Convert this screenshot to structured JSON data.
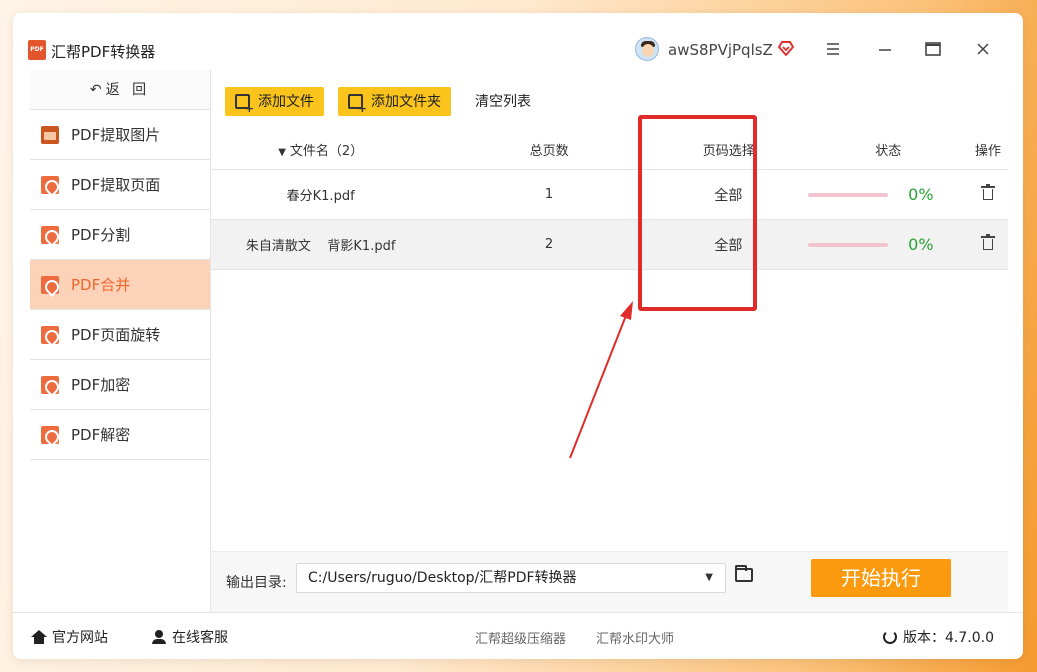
{
  "app": {
    "title": "汇帮PDF转换器",
    "logo_text": "PDF"
  },
  "user": {
    "name": "awS8PVjPqlsZ"
  },
  "sidebar": {
    "back_label": "返 回",
    "items": [
      {
        "label": "PDF提取图片",
        "icon": "image-icon"
      },
      {
        "label": "PDF提取页面",
        "icon": "pdf-icon"
      },
      {
        "label": "PDF分割",
        "icon": "pdf-icon"
      },
      {
        "label": "PDF合并",
        "icon": "pdf-icon",
        "active": true
      },
      {
        "label": "PDF页面旋转",
        "icon": "pdf-icon"
      },
      {
        "label": "PDF加密",
        "icon": "pdf-icon"
      },
      {
        "label": "PDF解密",
        "icon": "pdf-icon"
      }
    ]
  },
  "toolbar": {
    "add_file": "添加文件",
    "add_folder": "添加文件夹",
    "clear_list": "清空列表"
  },
  "table": {
    "headers": {
      "name": "文件名（2）",
      "pages": "总页数",
      "page_select": "页码选择",
      "status": "状态",
      "op": "操作"
    },
    "rows": [
      {
        "name": "春分K1.pdf",
        "pages": "1",
        "page_select": "全部",
        "progress_pct": "0%",
        "progress": 0
      },
      {
        "name": "朱自清散文    背影K1.pdf",
        "pages": "2",
        "page_select": "全部",
        "progress_pct": "0%",
        "progress": 0
      }
    ]
  },
  "output": {
    "label": "输出目录:",
    "path": "C:/Users/ruguo/Desktop/汇帮PDF转换器",
    "start_label": "开始执行"
  },
  "footer": {
    "website": "官方网站",
    "service": "在线客服",
    "link1": "汇帮超级压缩器",
    "link2": "汇帮水印大师",
    "version_label": "版本：4.7.0.0"
  },
  "colors": {
    "accent": "#fb9a0e",
    "toolbar_button": "#fac41c",
    "active_item_bg": "#fcd2b8",
    "active_item_text": "#f0642c",
    "progress_text": "#2aa233",
    "annotation": "#e02b2b"
  }
}
